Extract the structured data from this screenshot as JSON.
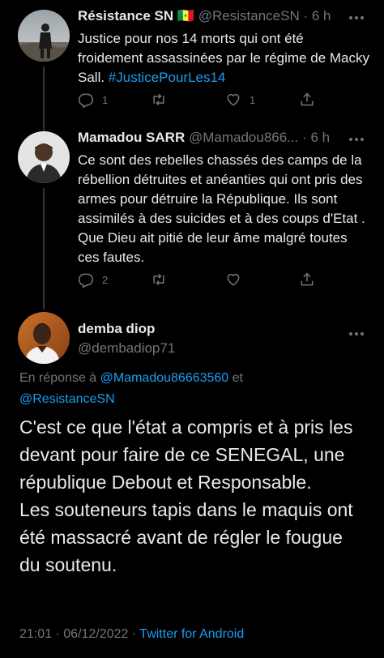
{
  "tweets": [
    {
      "name": "Résistance SN",
      "flag": "🇸🇳",
      "handle": "@ResistanceSN",
      "separator": "·",
      "time": "6 h",
      "text_before": "Justice pour nos 14 morts qui ont été froidement assassinées par le régime de Macky Sall. ",
      "hashtag": "#JusticePourLes14",
      "replies": "1",
      "retweets": "",
      "likes": "1"
    },
    {
      "name": "Mamadou SARR",
      "handle": "@Mamadou866...",
      "separator": "·",
      "time": "6 h",
      "text": "Ce sont des rebelles chassés des camps de la rébellion détruites et anéanties qui ont pris des armes pour détruire la République. Ils sont assimilés à des suicides et à des coups d'Etat . Que Dieu ait pitié de leur âme malgré toutes ces fautes.",
      "replies": "2",
      "retweets": "",
      "likes": ""
    }
  ],
  "main_tweet": {
    "name": "demba diop",
    "handle": "@dembadiop71",
    "reply_prefix": "En réponse à ",
    "reply_mention_1": "@Mamadou86663560",
    "reply_and": " et",
    "reply_mention_2": "@ResistanceSN",
    "text": "C'est ce que l'état a compris et à pris les devant pour faire de ce SENEGAL, une république Debout et Responsable.\nLes souteneurs tapis dans le maquis ont été massacré avant de régler le fougue du soutenu.",
    "time": "21:01",
    "dot1": "·",
    "date": "06/12/2022",
    "dot2": "·",
    "source": "Twitter for Android"
  },
  "icons": {
    "reply": "reply-icon",
    "retweet": "retweet-icon",
    "like": "heart-icon",
    "share": "share-icon",
    "more": "more-icon"
  },
  "colors": {
    "background": "#000000",
    "text": "#e7e9ea",
    "muted": "#71767b",
    "link": "#1d9bf0"
  }
}
